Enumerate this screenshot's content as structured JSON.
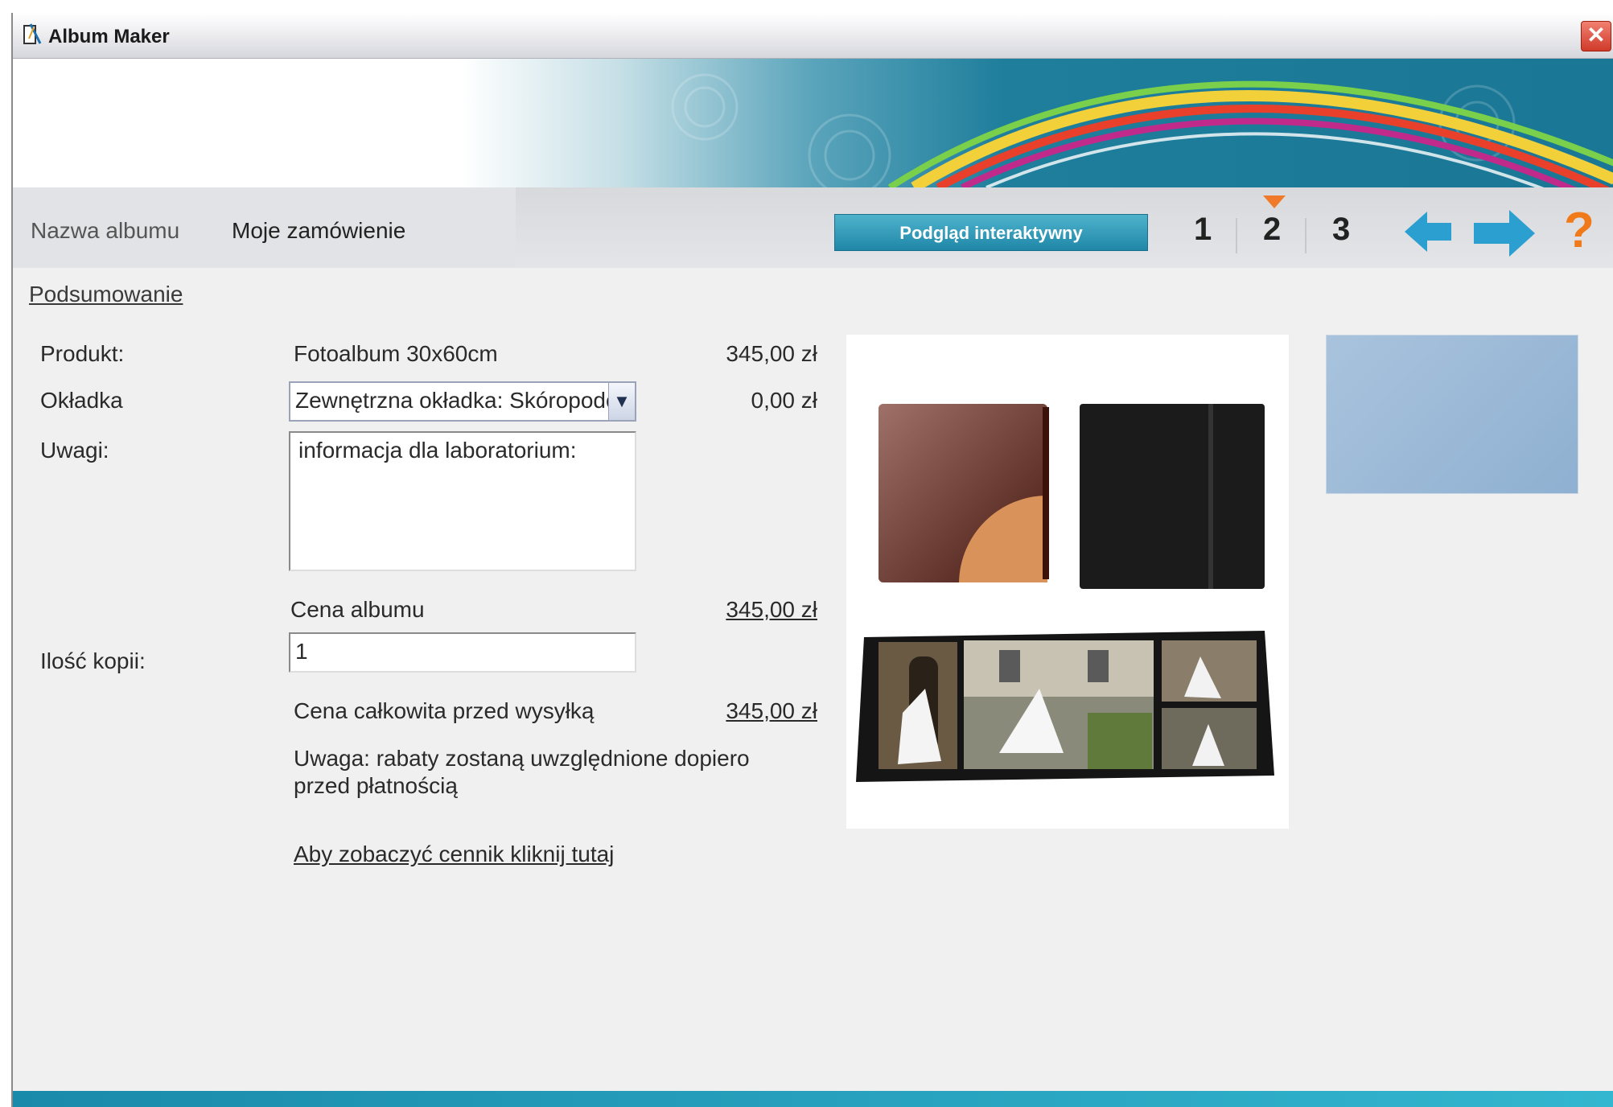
{
  "window": {
    "title": "Album Maker",
    "close_label": "✕"
  },
  "toolbar": {
    "album_name_label": "Nazwa albumu",
    "album_name_value": "Moje zamówienie",
    "preview_button": "Podgląd interaktywny",
    "steps": [
      "1",
      "2",
      "3"
    ],
    "active_step": "2",
    "help_label": "?"
  },
  "summary": {
    "section_link": "Podsumowanie",
    "product_label": "Produkt:",
    "product_value": "Fotoalbum 30x60cm",
    "product_price": "345,00 zł",
    "cover_label": "Okładka",
    "cover_value": "Zewnętrzna okładka: Skóropodobna",
    "cover_price": "0,00 zł",
    "notes_label": "Uwagi:",
    "notes_value": "informacja dla laboratorium:",
    "album_price_label": "Cena albumu",
    "album_price": "345,00 zł",
    "copies_label": "Ilość kopii:",
    "copies_value": "1",
    "total_label": "Cena całkowita przed wysyłką",
    "total_price": "345,00 zł",
    "note_line1": "Uwaga: rabaty zostaną uwzględnione dopiero",
    "note_line2": "przed płatnością",
    "pricelist_link": "Aby zobaczyć cennik kliknij tutaj"
  },
  "colors": {
    "accent": "#1f87a8",
    "step_marker": "#f07a2a",
    "help": "#f07a1a"
  },
  "icons": [
    "app-icon",
    "close-icon",
    "arrow-left-icon",
    "arrow-right-icon",
    "help-icon",
    "dropdown-arrow-icon"
  ]
}
